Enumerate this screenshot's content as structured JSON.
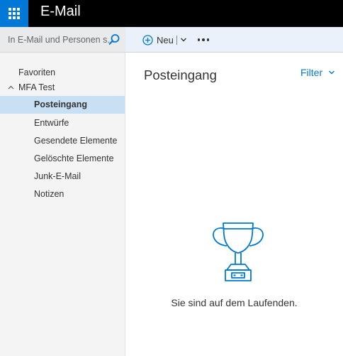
{
  "app": {
    "title": "E-Mail"
  },
  "search": {
    "placeholder": "In E-Mail und Personen s..."
  },
  "toolbar": {
    "new_label": "Neu"
  },
  "sidebar": {
    "favorites_label": "Favoriten",
    "account_label": "MFA Test",
    "folders": [
      {
        "label": "Posteingang",
        "selected": true
      },
      {
        "label": "Entwürfe"
      },
      {
        "label": "Gesendete Elemente"
      },
      {
        "label": "Gelöschte Elemente"
      },
      {
        "label": "Junk-E-Mail"
      },
      {
        "label": "Notizen"
      }
    ]
  },
  "main": {
    "title": "Posteingang",
    "filter_label": "Filter",
    "empty_message": "Sie sind auf dem Laufenden."
  },
  "colors": {
    "accent": "#0078d7",
    "selected_bg": "#c7e0f4",
    "topbar": "#000000",
    "sidebar_bg": "#f4f4f4"
  },
  "icons": [
    "app-launcher-icon",
    "search-icon",
    "plus-circle-icon",
    "chevron-down-icon",
    "more-icon",
    "caret-up-icon",
    "trophy-icon"
  ]
}
